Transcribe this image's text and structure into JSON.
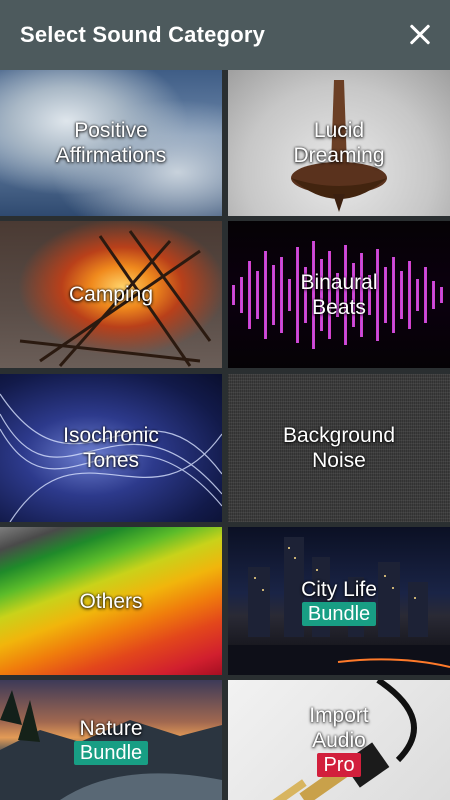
{
  "header": {
    "title": "Select Sound Category",
    "close_icon": "close-icon"
  },
  "colors": {
    "header_bg": "#4d5a5d",
    "bundle_badge": "#189e84",
    "pro_badge": "#d21f3c"
  },
  "categories": [
    {
      "label": "Positive\nAffirmations",
      "image": "cloudy-sky"
    },
    {
      "label": "Lucid\nDreaming",
      "image": "spinning-top"
    },
    {
      "label": "Camping",
      "image": "campfire"
    },
    {
      "label": "Binaural\nBeats",
      "image": "sound-waves"
    },
    {
      "label": "Isochronic\nTones",
      "image": "light-waves"
    },
    {
      "label": "Background\nNoise",
      "image": "static-noise"
    },
    {
      "label": "Others",
      "image": "colored-pencils"
    },
    {
      "label": "City Life",
      "badge": "Bundle",
      "image": "city-skyline"
    },
    {
      "label": "Nature",
      "badge": "Bundle",
      "image": "sunset-river"
    },
    {
      "label": "Import\nAudio",
      "badge": "Pro",
      "image": "audio-jack"
    }
  ]
}
